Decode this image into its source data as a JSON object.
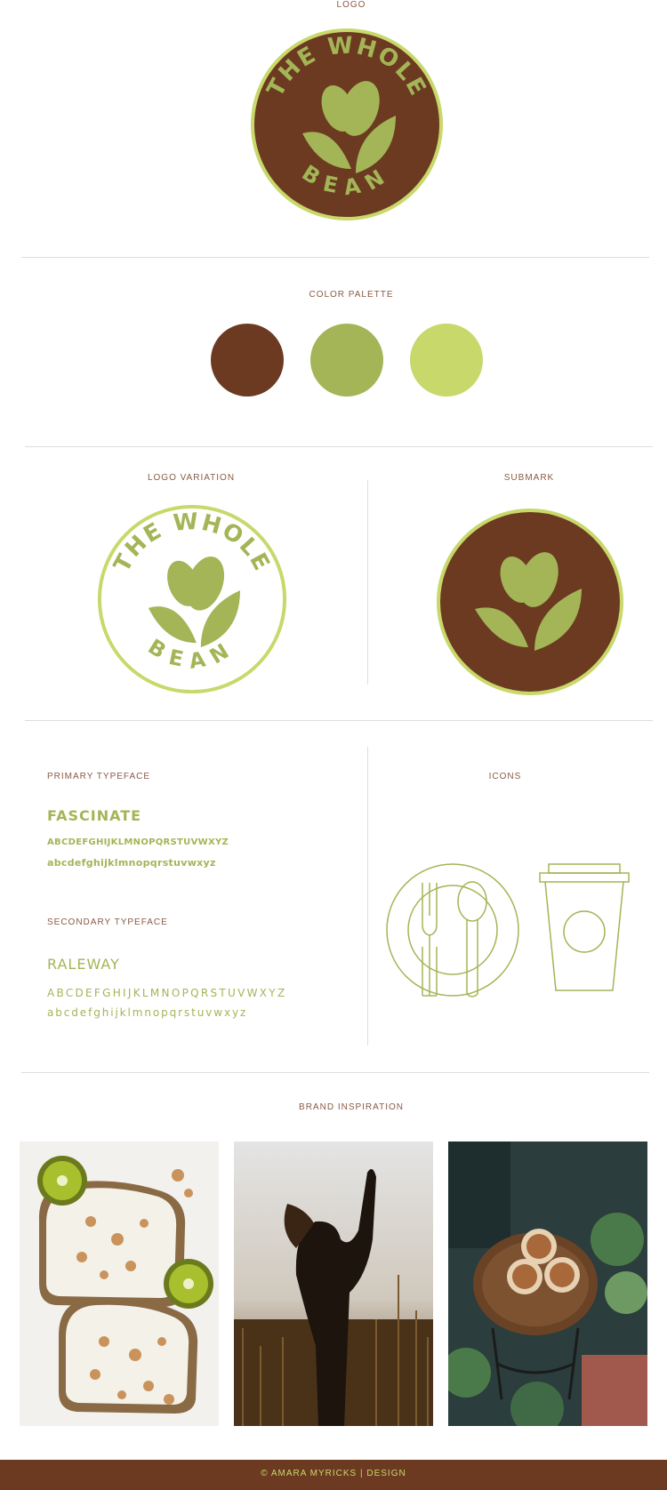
{
  "sections": {
    "logo": "LOGO",
    "palette": "COLOR PALETTE",
    "logo_variation": "LOGO VARIATION",
    "submark": "SUBMARK",
    "primary_typeface": "PRIMARY TYPEFACE",
    "icons": "ICONS",
    "secondary_typeface": "SECONDARY TYPEFACE",
    "inspiration": "BRAND INSPIRATION"
  },
  "brand": {
    "line1": "THE WHOLE",
    "line2": "BEAN"
  },
  "colors": {
    "brown": "#6b3a21",
    "green": "#a3b556",
    "light_green": "#c8d86a"
  },
  "typefaces": {
    "primary_name": "FASCINATE",
    "primary_upper": "ABCDEFGHIJKLMNOPQRSTUVWXYZ",
    "primary_lower": "abcdefghijklmnopqrstuvwxyz",
    "secondary_name": "RALEWAY",
    "secondary_upper": "ABCDEFGHIJKLMNOPQRSTUVWXYZ",
    "secondary_lower": "abcdefghijklmnopqrstuvwxyz"
  },
  "icons": [
    "plate-cutlery-icon",
    "coffee-cup-icon"
  ],
  "footer": "© AMARA MYRICKS | DESIGN"
}
